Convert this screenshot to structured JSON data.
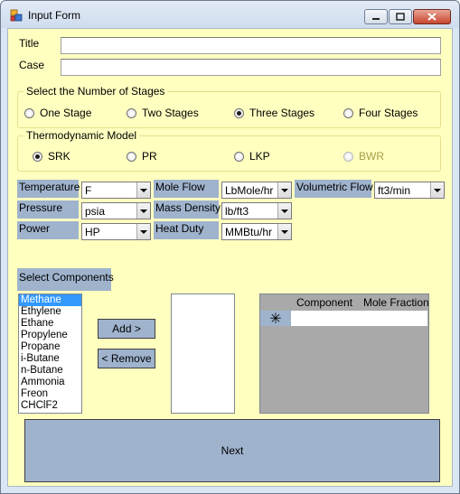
{
  "window": {
    "title": "Input Form"
  },
  "fields": {
    "title_label": "Title",
    "title_value": "",
    "case_label": "Case",
    "case_value": ""
  },
  "stages": {
    "legend": "Select the Number of Stages",
    "options": [
      "One Stage",
      "Two Stages",
      "Three Stages",
      "Four Stages"
    ],
    "selected": "Three Stages"
  },
  "thermo": {
    "legend": "Thermodynamic Model",
    "options": [
      "SRK",
      "PR",
      "LKP",
      "BWR"
    ],
    "selected": "SRK",
    "disabled": [
      "BWR"
    ]
  },
  "units": {
    "temperature": {
      "label": "Temperature",
      "value": "F"
    },
    "pressure": {
      "label": "Pressure",
      "value": "psia"
    },
    "power": {
      "label": "Power",
      "value": "HP"
    },
    "mole_flow": {
      "label": "Mole Flow",
      "value": "LbMole/hr"
    },
    "mass_density": {
      "label": "Mass Density",
      "value": "lb/ft3"
    },
    "heat_duty": {
      "label": "Heat Duty",
      "value": "MMBtu/hr"
    },
    "volumetric_flow": {
      "label": "Volumetric Flow",
      "value": "ft3/min"
    }
  },
  "components": {
    "label": "Select Components",
    "available": [
      "Methane",
      "Ethylene",
      "Ethane",
      "Propylene",
      "Propane",
      "i-Butane",
      "n-Butane",
      "Ammonia",
      "Freon",
      "CHClF2"
    ],
    "selected_index": 0,
    "add_label": "Add >",
    "remove_label": "< Remove"
  },
  "grid": {
    "columns": [
      "Component",
      "Mole Fraction"
    ],
    "new_row_marker": "✳"
  },
  "next_label": "Next",
  "colors": {
    "form_background": "#ffffc0",
    "label_background": "#9fb3cd",
    "selection": "#3399ff",
    "disabled_text": "#a6a04a"
  }
}
